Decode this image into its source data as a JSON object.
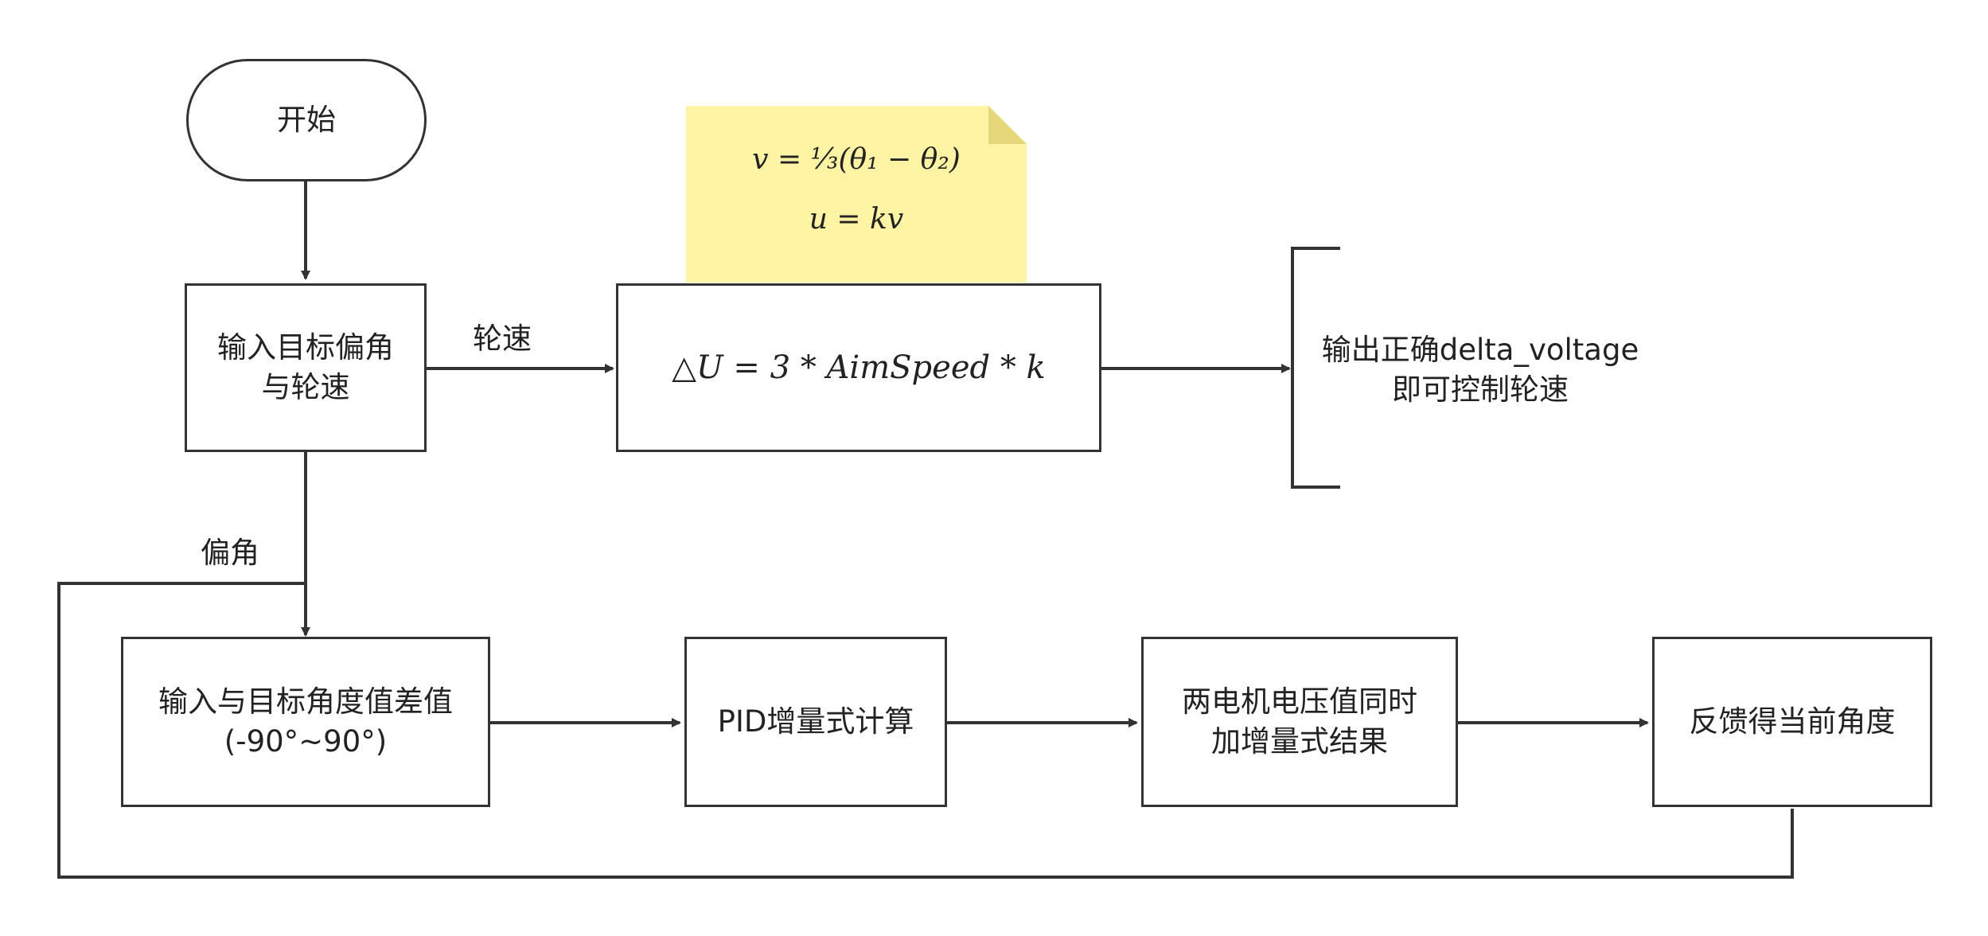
{
  "nodes": {
    "start": "开始",
    "input_target": [
      "输入目标偏角",
      "与轮速"
    ],
    "formula_speed": "△U = 3 * AimSpeed * k",
    "output": [
      "输出正确delta_voltage",
      "即可控制轮速"
    ],
    "input_diff": [
      "输入与目标角度值差值",
      "(-90°~90°)"
    ],
    "pid": "PID增量式计算",
    "apply": [
      "两电机电压值同时",
      "加增量式结果"
    ],
    "feedback": "反馈得当前角度"
  },
  "edge_labels": {
    "speed": "轮速",
    "angle": "偏角"
  },
  "note": {
    "line1": "v = ⅓(θ₁ − θ₂)",
    "line2": "u = kv"
  },
  "colors": {
    "stroke": "#333333",
    "note_fill": "#fff4a3",
    "note_fold": "#e6d77a"
  }
}
